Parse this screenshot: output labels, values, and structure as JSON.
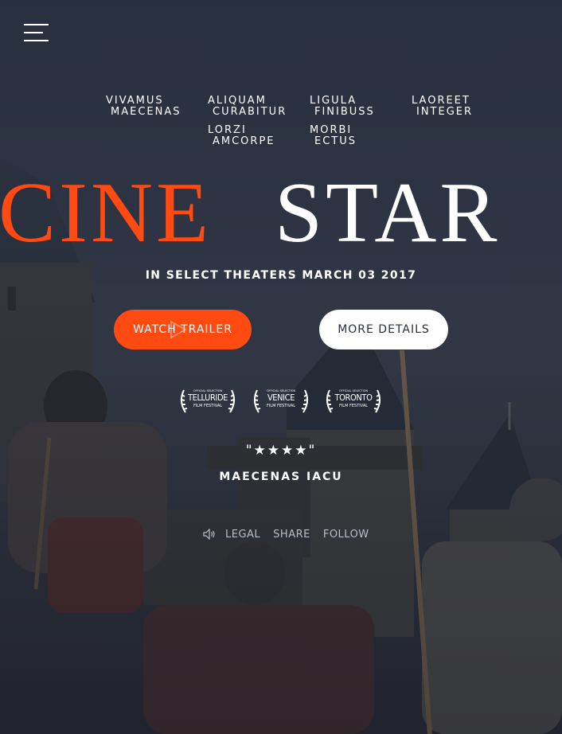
{
  "nav": {
    "items": [
      {
        "line1": "VIVAMUS",
        "line2": "MAECENAS"
      },
      {
        "line1": "ALIQUAM",
        "line2": "CURABITUR"
      },
      {
        "line1": "LIGULA",
        "line2": "FINIBUSS"
      },
      {
        "line1": "LAOREET",
        "line2": "INTEGER"
      },
      {
        "line1": "LORZI",
        "line2": "AMCORPE"
      },
      {
        "line1": "MORBI",
        "line2": "ECTUS"
      }
    ]
  },
  "hero": {
    "logo_part1": "CINE",
    "logo_part2": "STAR",
    "release_text": "IN SELECT THEATERS MARCH 03 2017",
    "watch_label": "WATCH TRAILER",
    "details_label": "MORE DETAILS"
  },
  "festivals": [
    {
      "small": "OFFICIAL SELECTION",
      "name": "TELLURIDE",
      "sub": "FILM FESTIVAL"
    },
    {
      "small": "OFFICIAL SELECTION",
      "name": "VENICE",
      "sub": "FILM FESTIVAL"
    },
    {
      "small": "OFFICIAL SELECTION",
      "name": "TORONTO",
      "sub": "FILM FESTIVAL"
    }
  ],
  "review": {
    "stars_text": "\"★★★★\"",
    "reviewer": "MAECENAS IACU"
  },
  "footer": {
    "links": [
      "LEGAL",
      "SHARE",
      "FOLLOW"
    ]
  },
  "colors": {
    "accent": "#ff4a12",
    "background": "#2a3142",
    "white": "#ffffff"
  },
  "icons": {
    "menu": "menu-icon",
    "play": "play-icon",
    "sound": "speaker-icon",
    "laurel": "laurel-icon"
  }
}
